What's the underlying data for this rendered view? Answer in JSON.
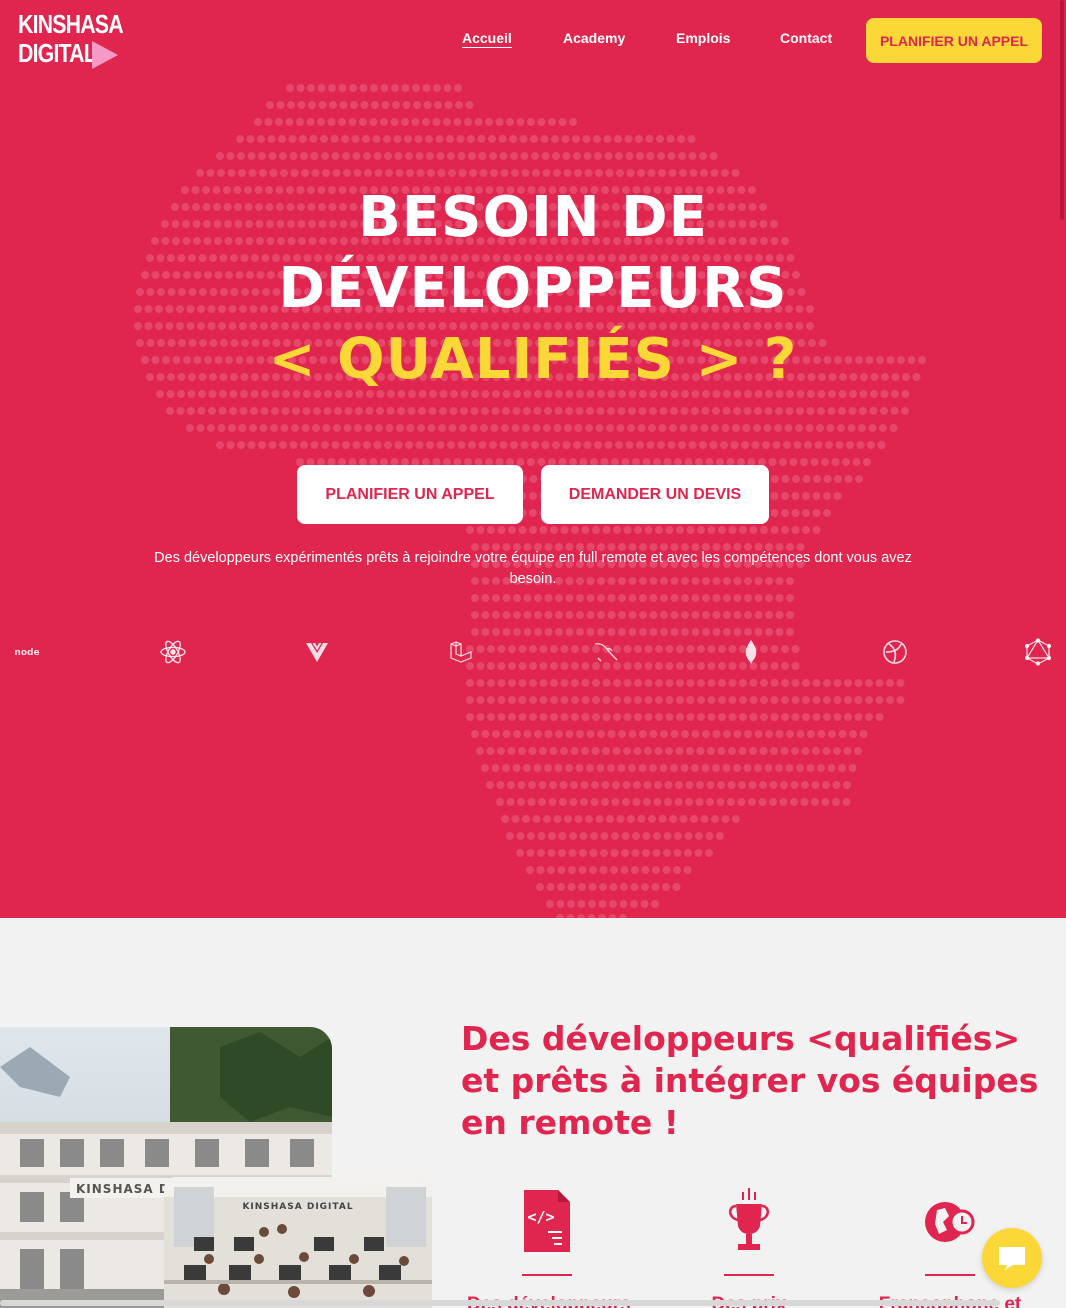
{
  "brand": {
    "logo_line1": "KINSHASA",
    "logo_line2": "DIGITAL"
  },
  "nav": {
    "items": [
      {
        "label": "Accueil",
        "active": true
      },
      {
        "label": "Academy",
        "active": false
      },
      {
        "label": "Emplois",
        "active": false
      },
      {
        "label": "Contact",
        "active": false
      }
    ],
    "cta_label": "PLANIFIER UN APPEL"
  },
  "hero": {
    "title_line1": "BESOIN DE",
    "title_line2": "DÉVELOPPEURS",
    "title_line3": "< QUALIFIÉS > ?",
    "primary_button": "PLANIFIER UN APPEL",
    "secondary_button": "DEMANDER UN DEVIS",
    "subtitle": "Des développeurs expérimentés prêts à rejoindre votre équipe en full remote et avec les compétences dont vous avez besoin.",
    "tech_icons": [
      "nodejs-icon",
      "react-icon",
      "vue-icon",
      "laravel-icon",
      "mysql-icon",
      "mongodb-icon",
      "redux-icon",
      "graphql-icon"
    ]
  },
  "section2": {
    "title": "Des développeurs <qualifiés> et prêts à intégrer vos équipes en remote !",
    "features": [
      {
        "icon": "code-file-icon",
        "label": "Des développeurs"
      },
      {
        "icon": "trophy-icon",
        "label": "Des prix"
      },
      {
        "icon": "globe-clock-icon",
        "label": "Francophone et"
      }
    ],
    "photo_main_sign": "KINSHASA DI",
    "photo_inner_sign": "KINSHASA DIGITAL"
  },
  "colors": {
    "brand_red": "#e0254f",
    "brand_yellow": "#fbd838",
    "logo_accent": "#f59ac6",
    "section_bg": "#f2f2f2"
  }
}
